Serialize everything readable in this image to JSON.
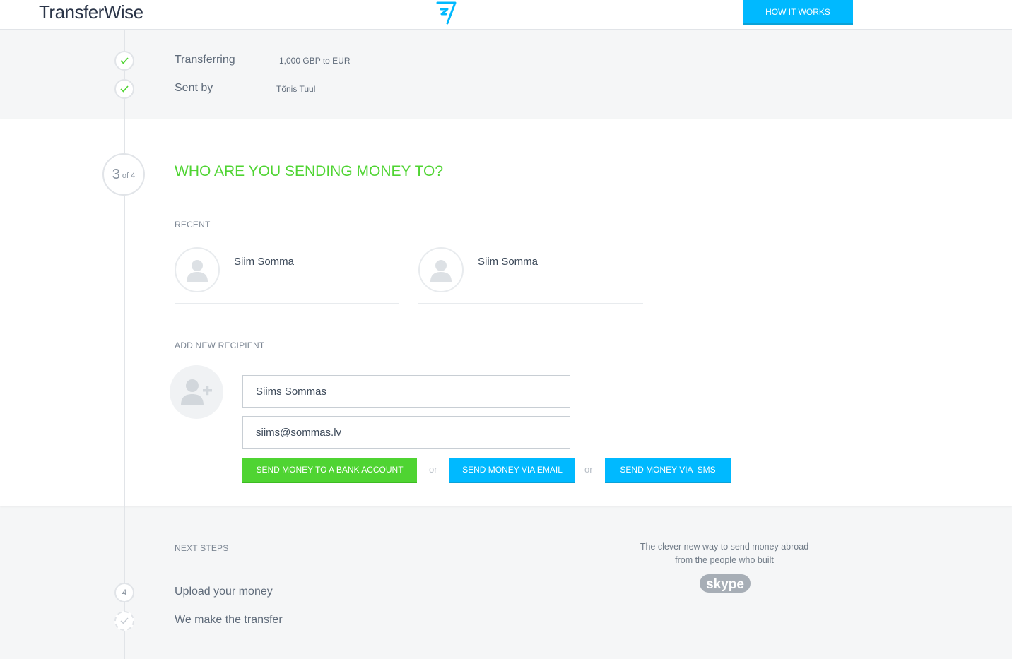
{
  "header": {
    "logo_text": "TransferWise",
    "how_it_works_label": "HOW IT WORKS"
  },
  "summary": [
    {
      "label": "Transferring",
      "value": "1,000 GBP to EUR"
    },
    {
      "label": "Sent by",
      "value": "Tõnis Tuul"
    }
  ],
  "current_step": {
    "number": "3",
    "of_text": "of 4",
    "title": "WHO ARE YOU SENDING MONEY TO?"
  },
  "recent": {
    "label": "RECENT",
    "recipients": [
      {
        "name": "Siim Somma"
      },
      {
        "name": "Siim Somma"
      }
    ]
  },
  "add_new": {
    "label": "ADD NEW RECIPIENT",
    "name_value": "Siims Sommas",
    "email_value": "siims@sommas.lv",
    "or_text": "or",
    "buttons": {
      "bank": "SEND MONEY TO A BANK ACCOUNT",
      "email": "SEND MONEY VIA EMAIL",
      "sms": "SEND MONEY VIA  SMS"
    }
  },
  "next_steps": {
    "label": "NEXT STEPS",
    "items": [
      {
        "number": "4",
        "label": "Upload your money"
      },
      {
        "number": "",
        "label": "We make the transfer"
      }
    ]
  },
  "promo": {
    "line1": "The clever new way to send money abroad",
    "line2": "from the people who built",
    "brand": "skype"
  },
  "colors": {
    "brand_blue": "#00b9ff",
    "brand_green": "#4fd432",
    "text_dark": "#2b3548"
  }
}
